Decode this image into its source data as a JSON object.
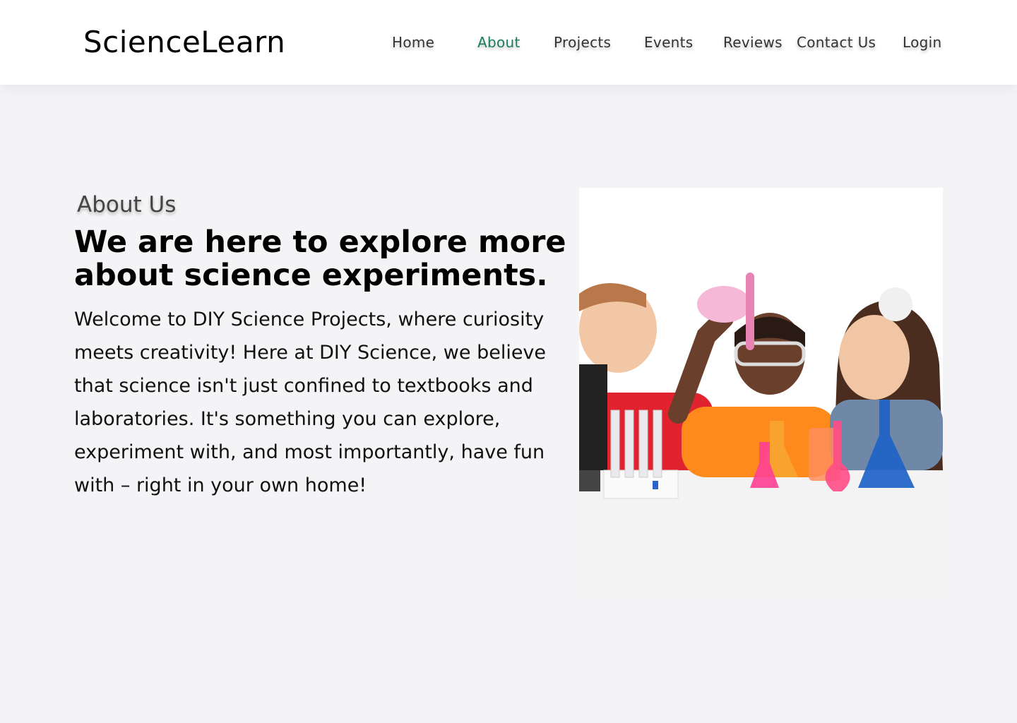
{
  "brand": {
    "name": "ScienceLearn"
  },
  "nav": {
    "items": [
      {
        "label": "Home",
        "active": false
      },
      {
        "label": "About",
        "active": true
      },
      {
        "label": "Projects",
        "active": false
      },
      {
        "label": "Events",
        "active": false
      },
      {
        "label": "Reviews",
        "active": false
      },
      {
        "label": "Contact Us",
        "active": false
      },
      {
        "label": "Login",
        "active": false
      }
    ],
    "active_color": "#1a7f5a"
  },
  "about": {
    "section_label": "About Us",
    "headline": "We are here to explore more about science experiments.",
    "body": "Welcome to DIY Science Projects, where curiosity meets creativity! Here at DIY Science, we believe that science isn't just confined to textbooks and laboratories. It's something you can explore, experiment with, and most importantly, have fun with – right in your own home!"
  },
  "image": {
    "icon": "kids-science-experiment-photo"
  }
}
